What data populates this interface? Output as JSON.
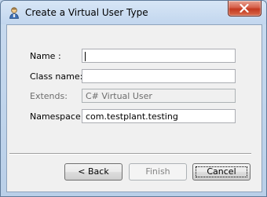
{
  "window": {
    "title": "Create a Virtual User Type"
  },
  "form": {
    "name": {
      "label": "Name :",
      "value": ""
    },
    "class_name": {
      "label": "Class name:",
      "value": ""
    },
    "extends": {
      "label": "Extends:",
      "value": "C# Virtual User"
    },
    "namespace": {
      "label": "Namespace:",
      "value": "com.testplant.testing"
    }
  },
  "buttons": {
    "back": "< Back",
    "finish": "Finish",
    "cancel": "Cancel"
  },
  "icons": {
    "app": "virtual-user-icon",
    "close": "close-icon"
  },
  "colors": {
    "close_button": "#c3391f",
    "title_bar": "#c2d6ee"
  }
}
